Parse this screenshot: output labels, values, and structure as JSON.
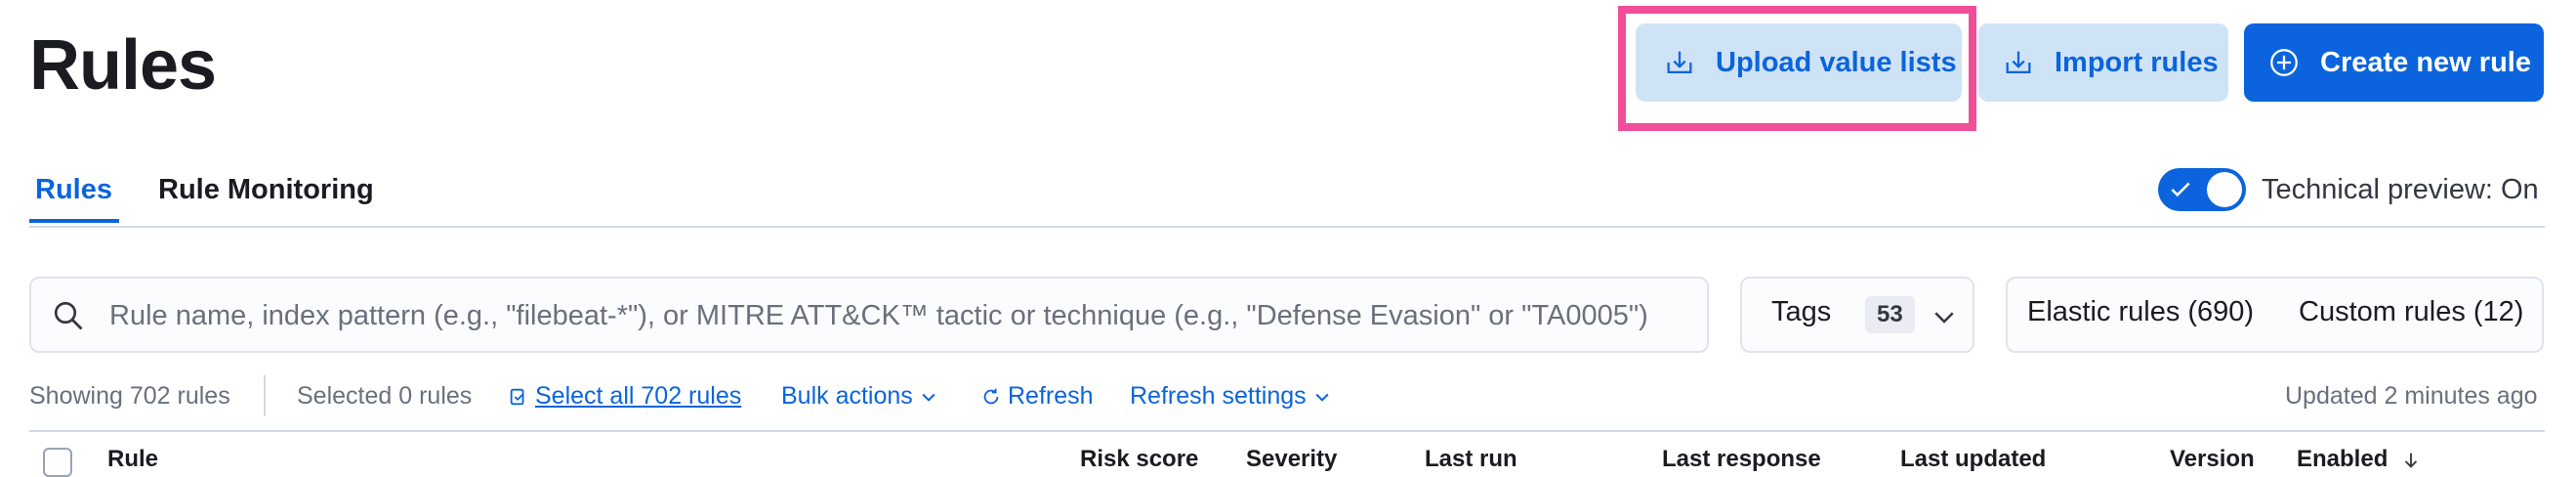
{
  "page_title": "Rules",
  "header_buttons": {
    "upload": "Upload value lists",
    "import": "Import rules",
    "create": "Create new rule"
  },
  "tabs": [
    {
      "label": "Rules",
      "active": true
    },
    {
      "label": "Rule Monitoring",
      "active": false
    }
  ],
  "technical_preview": {
    "label": "Technical preview: On",
    "enabled": true
  },
  "search": {
    "placeholder": "Rule name, index pattern (e.g., \"filebeat-*\"), or MITRE ATT&CK™ tactic or technique (e.g., \"Defense Evasion\" or \"TA0005\")",
    "value": ""
  },
  "tags_filter": {
    "label": "Tags",
    "count": "53"
  },
  "rule_filters": {
    "elastic": "Elastic rules (690)",
    "custom": "Custom rules (12)"
  },
  "utility_bar": {
    "showing": "Showing 702 rules",
    "selected": "Selected 0 rules",
    "select_all": "Select all 702 rules",
    "bulk_actions": "Bulk actions",
    "refresh": "Refresh",
    "refresh_settings": "Refresh settings",
    "updated": "Updated 2 minutes ago"
  },
  "table_headers": [
    "Rule",
    "Risk score",
    "Severity",
    "Last run",
    "Last response",
    "Last updated",
    "Version",
    "Enabled"
  ],
  "colors": {
    "primary": "#0b64dd",
    "highlight": "#f04e98",
    "light_primary": "#cfe3f7"
  },
  "icons": [
    "upload-icon",
    "import-icon",
    "plus-circle-icon",
    "check-icon",
    "search-icon",
    "chevron-down-icon",
    "select-all-icon",
    "refresh-icon",
    "sort-down-icon"
  ]
}
